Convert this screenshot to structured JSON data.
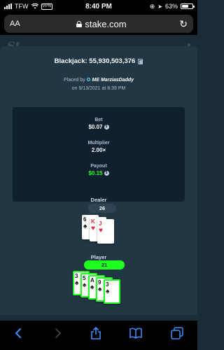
{
  "status_bar": {
    "carrier": "TFW",
    "vpn": "VPN",
    "time": "8:40 PM",
    "battery": "63%"
  },
  "browser": {
    "aa_label": "AA",
    "url": "stake.com"
  },
  "bet": {
    "title": "Blackjack: 55,930,503,376",
    "placed_by_prefix": "Placed by",
    "placed_by_user": "ME MarziasDaddy",
    "placed_on": "on 9/13/2021 at 8:39 PM"
  },
  "stats": {
    "bet_label": "Bet",
    "bet_value": "$0.07",
    "multiplier_label": "Multiplier",
    "multiplier_value": "2.00×",
    "payout_label": "Payout",
    "payout_value": "$0.15"
  },
  "dealer": {
    "label": "Dealer",
    "score": "26",
    "cards": [
      {
        "rank": "6",
        "suit": "♠",
        "color": "black"
      },
      {
        "rank": "K",
        "suit": "♥",
        "color": "red"
      },
      {
        "rank": "J",
        "suit": "♥",
        "color": "red"
      }
    ]
  },
  "player": {
    "label": "Player",
    "score": "21",
    "cards": [
      {
        "rank": "3",
        "suit": "♠",
        "color": "black"
      },
      {
        "rank": "5",
        "suit": "♠",
        "color": "black"
      },
      {
        "rank": "A",
        "suit": "♠",
        "color": "black"
      },
      {
        "rank": "9",
        "suit": "♠",
        "color": "black"
      },
      {
        "rank": "3",
        "suit": "♠",
        "color": "black"
      }
    ]
  },
  "colors": {
    "modal_bg": "#213743",
    "panel_bg": "#0f212e",
    "win_green": "#1fff20",
    "page_bg": "#1a2c38"
  },
  "icons": [
    "signal-icon",
    "wifi-icon",
    "lock-icon",
    "reload-icon",
    "copy-icon",
    "star-icon",
    "coin-icon",
    "back-icon",
    "forward-icon",
    "share-icon",
    "bookmarks-icon",
    "tabs-icon",
    "location-icon",
    "battery-icon"
  ]
}
